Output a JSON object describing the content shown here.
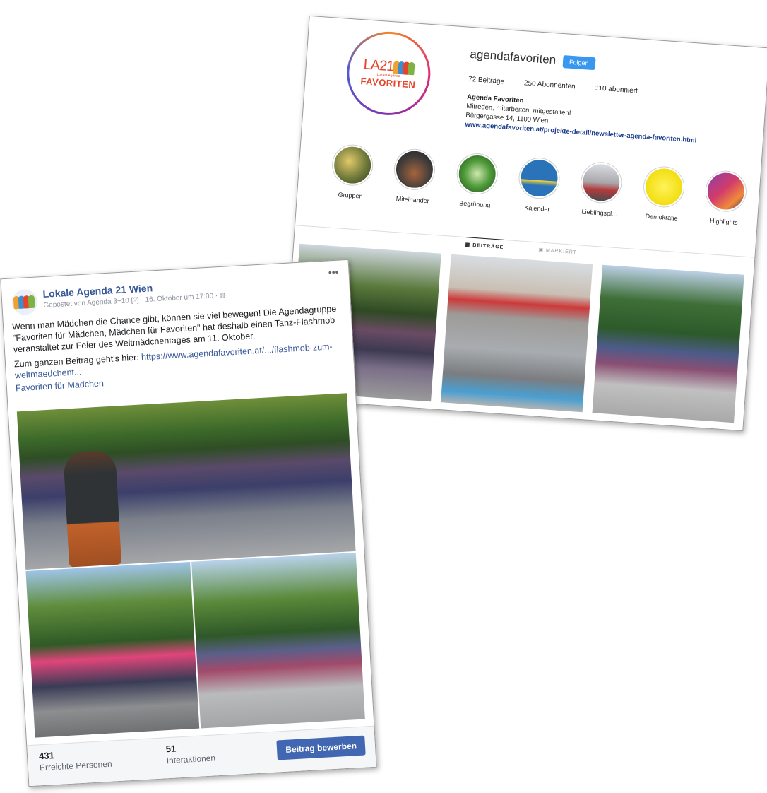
{
  "instagram": {
    "logo": {
      "la21": "LA21",
      "subline": "Lokale Agenda",
      "wordmark": "FAVORITEN"
    },
    "username": "agendafavoriten",
    "follow_label": "Folgen",
    "stats": {
      "posts": "72 Beiträge",
      "followers": "250 Abonnenten",
      "following": "110 abonniert"
    },
    "bio": {
      "name": "Agenda Favoriten",
      "line1": "Mitreden, mitarbeiten, mitgestalten!",
      "line2": "Bürgergasse 14, 1100 Wien",
      "link": "www.agendafavoriten.at/projekte-detail/newsletter-agenda-favoriten.html"
    },
    "highlights": [
      {
        "label": "Gruppen"
      },
      {
        "label": "Miteinander"
      },
      {
        "label": "Begrünung"
      },
      {
        "label": "Kalender"
      },
      {
        "label": "Lieblingspl..."
      },
      {
        "label": "Demokratie"
      },
      {
        "label": "Highlights"
      }
    ],
    "tabs": {
      "posts": "BEITRÄGE",
      "tagged": "MARKIERT"
    }
  },
  "facebook": {
    "page_name": "Lokale Agenda 21 Wien",
    "meta": "Gepostet von Agenda 3+10 [?] · 16. Oktober um 17:00 · ",
    "menu": "•••",
    "text1": "Wenn man Mädchen die Chance gibt, können sie viel bewegen! Die Agendagruppe \"Favoriten für Mädchen, Mädchen für Favoriten\" hat deshalb einen Tanz-Flashmob veranstaltet zur Feier des Weltmädchentages am 11. Oktober.",
    "text2_prefix": "Zum ganzen Beitrag geht's hier: ",
    "text2_link": "https://www.agendafavoriten.at/.../flashmob-zum-weltmaedchent...",
    "tag": "Favoriten für Mädchen",
    "reach": {
      "value": "431",
      "label": "Erreichte Personen"
    },
    "interactions": {
      "value": "51",
      "label": "Interaktionen"
    },
    "promote_label": "Beitrag bewerben"
  },
  "colors": {
    "fb_blue": "#385898",
    "fb_button": "#4267b2",
    "ig_follow": "#3897f0",
    "logo_red": "#e7432b"
  }
}
